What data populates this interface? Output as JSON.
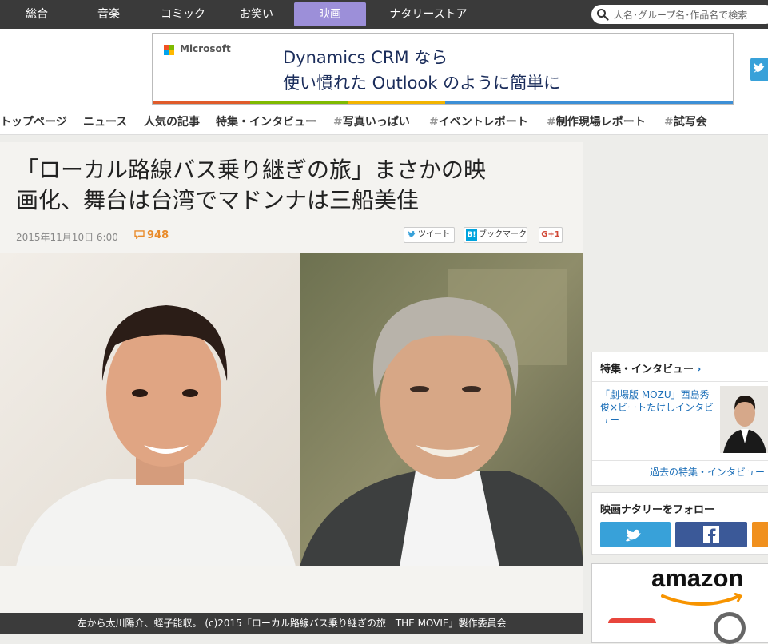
{
  "topnav": {
    "items": [
      "総合",
      "音楽",
      "コミック",
      "お笑い",
      "映画",
      "ナタリーストア"
    ],
    "active": "映画",
    "search_placeholder": "人名･グループ名･作品名で検索"
  },
  "ad": {
    "brand": "Microsoft",
    "line1": "Dynamics CRM なら",
    "line2": "使い慣れた Outlook のように簡単に"
  },
  "subnav": {
    "items": [
      "トップページ",
      "ニュース",
      "人気の記事",
      "特集・インタビュー",
      "写真いっぱい",
      "イベントレポート",
      "制作現場レポート",
      "試写会"
    ],
    "hash": "#"
  },
  "article": {
    "headline_line1": "「ローカル路線バス乗り継ぎの旅」まさかの映",
    "headline_line2": "画化、舞台は台湾でマドンナは三船美佳",
    "date": "2015年11月10日 6:00",
    "comment_count": "948",
    "share_tweet": "ツイート",
    "share_bookmark": "ブックマーク",
    "share_gplus": "G+1",
    "caption": "左から太川陽介、蛭子能収。 (c)2015「ローカル路線バス乗り継ぎの旅　THE MOVIE」製作委員会"
  },
  "sidebar": {
    "feature_title": "特集・インタビュー",
    "feature_item": "「劇場版 MOZU」西島秀俊×ビートたけしインタビュー",
    "feature_more": "過去の特集・インタビュー",
    "follow_title": "映画ナタリーをフォロー",
    "amazon_logo": "amazon"
  },
  "colors": {
    "nav_bg": "#3a3a3a",
    "nav_active": "#9c8fd9",
    "link": "#1c6fb8",
    "accent_orange": "#e98b2a",
    "twitter": "#38a1d9",
    "facebook": "#3b5998"
  }
}
